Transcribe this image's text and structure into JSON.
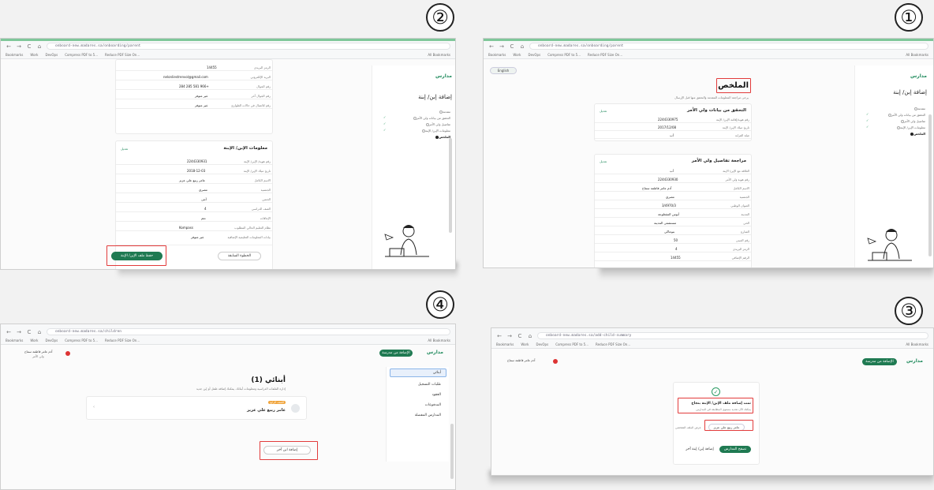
{
  "markers": [
    "②",
    "①",
    "④",
    "③"
  ],
  "browser": {
    "bookmarks": [
      "Bookmarks",
      "Work",
      "DevOps",
      "Compress PDF to 5...",
      "Reduce PDF Size On..."
    ],
    "all_bookmarks": "All Bookmarks",
    "nav": [
      "←",
      "→",
      "C",
      "⌂"
    ]
  },
  "app": {
    "brand": "مدارس",
    "add_child_title": "إضافة إبن/ إبنة",
    "steps": [
      "مقدمة",
      "التحقق من بيانات ولي الأمر",
      "تفاصيل ولي الأمر",
      "معلومات الإبن/ الإبنة",
      "الملخص"
    ]
  },
  "shot1": {
    "url": "onboard-new.madares.sa/onboarding/parent",
    "lang": "English",
    "heading": "الملخص",
    "subtext": "يرجى مراجعة المعلومات المقدمة والتحقق منها قبل الإرسال",
    "card1_title": "التحقق من بيانات ولي الأمر",
    "card1_edit": "تعديل",
    "card1_rows": [
      [
        "رقم هوية/إقامة الإبن/ الإبنة",
        "2244330975"
      ],
      [
        "تاريخ ميلاد الإبن/ الإبنة",
        "2017/12/08"
      ],
      [
        "صلة القرابة",
        "أب"
      ]
    ],
    "card2_title": "مراجعة تفاصيل ولي الأمر",
    "card2_edit": "تعديل",
    "card2_rows": [
      [
        "العلاقة مع الإبن/ الإبنة",
        "أب"
      ],
      [
        "رقم هوية ولي الأمر",
        "2244330930"
      ],
      [
        "الاسم الكامل",
        "آدم عامر فاطمة سماح"
      ],
      [
        "الجنسية",
        "مصري"
      ],
      [
        "العنوان الوطني",
        "3/4970/3"
      ],
      [
        "المدينة",
        "أبوس المقطوعة"
      ],
      [
        "الحي",
        "مستشفى المدينة"
      ],
      [
        "الشارع",
        "بنوعاكي"
      ],
      [
        "رقم المبنى",
        "50"
      ],
      [
        "الرمز البريدي",
        "4"
      ],
      [
        "الرقم الإضافي",
        "14455"
      ]
    ]
  },
  "shot2": {
    "url": "onboard-new.madares.sa/onboarding/parent",
    "top_rows": [
      [
        "الرمز البريدي",
        "14455"
      ],
      [
        "البريد الإلكتروني",
        "nelonliestrenvol@gmail.com"
      ],
      [
        "رقم الجوال",
        "+966 581 285 284"
      ],
      [
        "رقم الجوال آخر",
        "غير متوفر"
      ],
      [
        "رقم للاتصال في حالات الطوارئ",
        "غير متوفر"
      ]
    ],
    "child_title": "معلومات الإبن/ الإبنة",
    "child_edit": "تعديل",
    "child_rows": [
      [
        "رقم هوية/ الإبن/ الإبنة",
        "2244330931"
      ],
      [
        "تاريخ ميلاد الإبن/ الإبنة",
        "2018-12-03"
      ],
      [
        "الاسم الكامل",
        "عامر ربيع علي عزيز"
      ],
      [
        "الجنسية",
        "مصري"
      ],
      [
        "الجنس",
        "أنثى"
      ],
      [
        "الصف الدراسي",
        "4"
      ],
      [
        "الإعاقات",
        "نعم"
      ],
      [
        "نظام التعليم الحالي المطلوب",
        "Kompass"
      ],
      [
        "بيانات المعلومات التعليمية الإضافية",
        "غير متوفر"
      ]
    ],
    "submit_label": "حفظ ملف الإبن/ الإبنة",
    "prev_label": "الخطوة السابقة"
  },
  "shot3": {
    "url": "onboard-new.madares.sa/add-child-summary",
    "top_btn": "الإضافة من مدرسة",
    "success_title": "تمت إضافة ملف الإبن/ الإبنة بنجاح",
    "success_sub": "يمكنك الآن تحديد مستوى المطابقة في المدارس",
    "child_chip": "عامر ربيع علي عزيز",
    "chip_alt": "عرض الملف الشخصي",
    "primary_btn": "تصفح المدارس",
    "secondary_btn": "إضافة إبن/ إبنة آخر"
  },
  "shot4": {
    "url": "onboard-new.madares.sa/children",
    "top_btn": "الإضافة من مدرسة",
    "user_name": "آدم عامر فاطمة سماح",
    "user_role": "ولي الأمر",
    "heading": "أبنائي (1)",
    "subtext": "إدارة الملفات الدراسية ومعلومات أبنائك. يمكنك إضافة طفل أو إبن جديد",
    "menu": [
      "أبنائي",
      "طلبات التسجيل",
      "العقود",
      "المدفوعات",
      "المدارس المفضلة"
    ],
    "child_badge": "الصف الرابع",
    "child_name": "عامر ربيع علي عزيز",
    "add_child_btn": "إضافة ابن آخر"
  }
}
